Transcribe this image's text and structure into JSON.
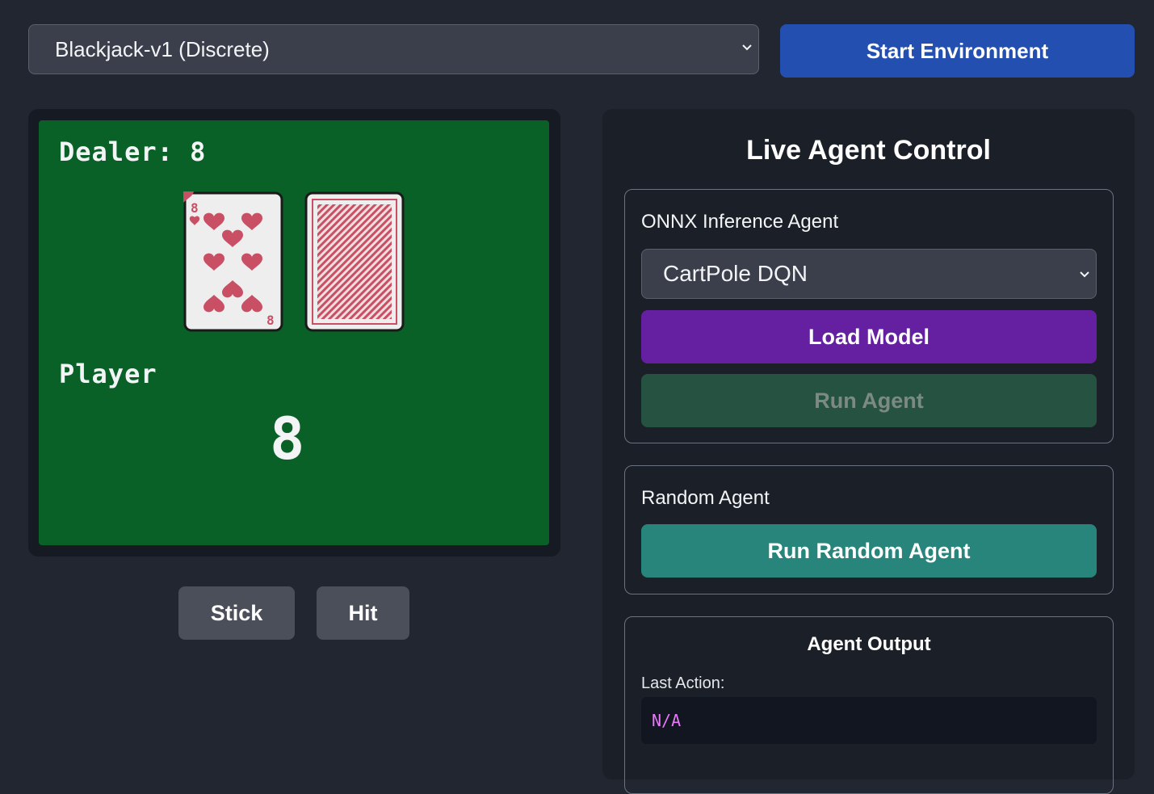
{
  "environment": {
    "selected": "Blackjack-v1 (Discrete)",
    "start_label": "Start Environment"
  },
  "game": {
    "dealer_label": "Dealer: 8",
    "player_label": "Player",
    "player_sum": "8",
    "dealer_card_rank": "8",
    "dealer_card_suit": "hearts",
    "card_color": "#c94f64",
    "table_color": "#096127"
  },
  "controls": {
    "stick_label": "Stick",
    "hit_label": "Hit"
  },
  "panel": {
    "title": "Live Agent Control",
    "onnx": {
      "heading": "ONNX Inference Agent",
      "model_selected": "CartPole DQN",
      "load_label": "Load Model",
      "run_label": "Run Agent"
    },
    "random": {
      "heading": "Random Agent",
      "run_label": "Run Random Agent"
    },
    "output": {
      "heading": "Agent Output",
      "last_action_label": "Last Action:",
      "last_action_value": "N/A"
    }
  },
  "icons": {
    "select_chevron": "chevron-down-icon",
    "heart": "heart-icon",
    "card_back": "card-back-pattern"
  }
}
